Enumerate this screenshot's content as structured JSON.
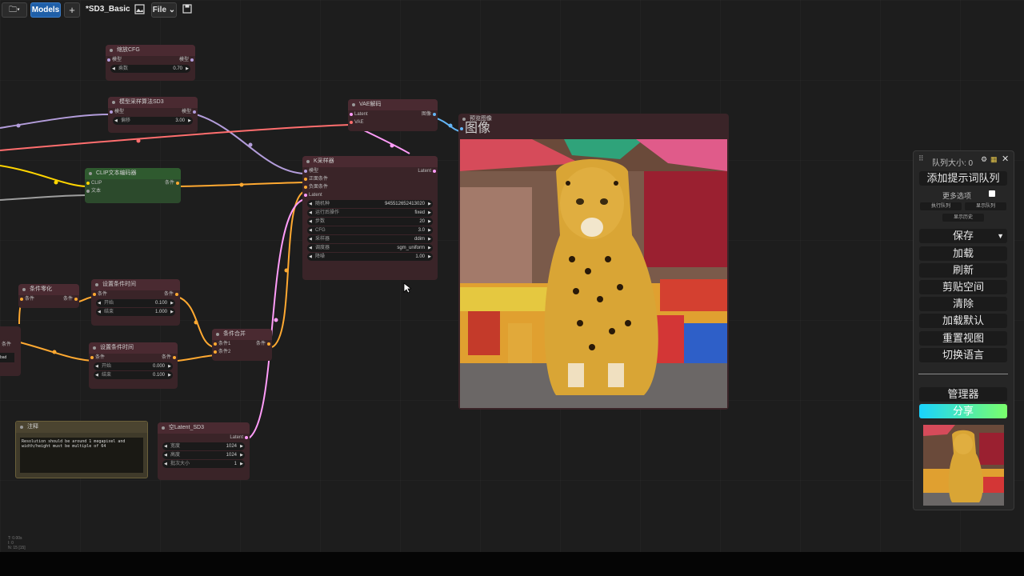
{
  "topbar": {
    "folder_icon": "folder-icon",
    "models_label": "Models",
    "add_label": "+",
    "workflow_title": "*SD3_Basic",
    "image_icon": "image-icon",
    "file_label": "File",
    "save_icon": "floppy-icon"
  },
  "nodes": {
    "cfg_scale": {
      "title": "缩放CFG",
      "in_label": "模型",
      "out_label": "模型",
      "w_label": "乘数",
      "w_value": "0.70"
    },
    "model_sampling": {
      "title": "模型采样算法SD3",
      "in_label": "模型",
      "out_label": "模型",
      "w_label": "偏移",
      "w_value": "3.00"
    },
    "vae_decode": {
      "title": "VAE解码",
      "in1": "Latent",
      "in2": "VAE",
      "out_label": "图像"
    },
    "clip_encode": {
      "title": "CLIP文本编码器",
      "in1": "CLIP",
      "in2": "文本",
      "out_label": "条件"
    },
    "ksampler": {
      "title": "K采样器",
      "in1": "模型",
      "in2": "正面条件",
      "in3": "负面条件",
      "in4": "Latent",
      "out_label": "Latent",
      "widgets": [
        {
          "label": "随机种",
          "value": "945512652413020"
        },
        {
          "label": "运行后操作",
          "value": "fixed"
        },
        {
          "label": "步数",
          "value": "20"
        },
        {
          "label": "CFG",
          "value": "3.0"
        },
        {
          "label": "采样器",
          "value": "ddim"
        },
        {
          "label": "调度器",
          "value": "sgm_uniform"
        },
        {
          "label": "降噪",
          "value": "1.00"
        }
      ]
    },
    "cond_zero": {
      "title": "条件零化",
      "in_label": "条件",
      "out_label": "条件"
    },
    "set_timestep_1": {
      "title": "设置条件时间",
      "in_label": "条件",
      "out_label": "条件",
      "w1_label": "开始",
      "w1_value": "0.100",
      "w2_label": "结束",
      "w2_value": "1.000"
    },
    "set_timestep_2": {
      "title": "设置条件时间",
      "in_label": "条件",
      "out_label": "条件",
      "w1_label": "开始",
      "w1_value": "0.000",
      "w2_label": "结束",
      "w2_value": "0.100"
    },
    "cond_combine": {
      "title": "条件合并",
      "in1": "条件1",
      "in2": "条件2",
      "out_label": "条件"
    },
    "left_partial": {
      "label": "条件",
      "text": "bad"
    },
    "note": {
      "title": "注释",
      "text": "Resolution should be around 1 megapixel and width/height must be multiple of 64"
    },
    "empty_latent": {
      "title": "空Latent_SD3",
      "out_label": "Latent",
      "widgets": [
        {
          "label": "宽度",
          "value": "1024"
        },
        {
          "label": "高度",
          "value": "1024"
        },
        {
          "label": "批次大小",
          "value": "1"
        }
      ]
    },
    "preview": {
      "title": "预览图像",
      "in_label": "图像"
    }
  },
  "panel": {
    "queue_size": "队列大小: 0",
    "add_queue": "添加提示词队列",
    "more_options": "更多选项",
    "exec_queue": "执行队列",
    "show_queue": "显示队列",
    "show_history": "显示历史",
    "save": "保存",
    "load": "加载",
    "refresh": "刷新",
    "clipspace": "剪贴空间",
    "clear": "清除",
    "load_default": "加载默认",
    "reset_view": "重置视图",
    "switch_lang": "切换语言",
    "manager": "管理器",
    "share": "分享"
  },
  "stats": {
    "t": "T: 0.00s",
    "i": "I: 0",
    "n": "N: 15 [15]"
  },
  "colors": {
    "model": "#b39ddb",
    "clip": "#ffd500",
    "cond": "#ffa931",
    "latent": "#ff9cf9",
    "vae": "#ff6e6e",
    "image": "#64b5f6",
    "share_start": "#19d3ff",
    "share_end": "#7bff6b"
  }
}
